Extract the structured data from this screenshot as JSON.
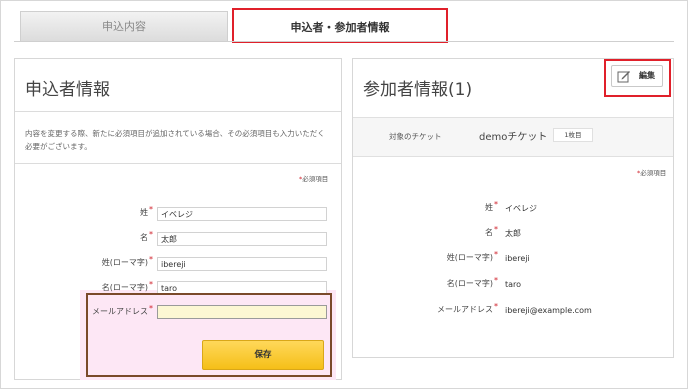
{
  "tabs": [
    {
      "label": "申込内容"
    },
    {
      "label": "申込者・参加者情報"
    }
  ],
  "applicant": {
    "title": "申込者情報",
    "notice": "内容を変更する際、新たに必須項目が追加されている場合、その必須項目も入力いただく必要がございます。",
    "required_mark": "*",
    "required_note": "必須項目",
    "fields": [
      {
        "label": "姓",
        "value": ""
      },
      {
        "label": "名",
        "value": ""
      },
      {
        "label": "姓(ローマ字)",
        "value": "ibereji"
      },
      {
        "label": "名(ローマ字)",
        "value": "taro"
      },
      {
        "label": "メールアドレス",
        "value": ""
      }
    ],
    "field_values_jp": [
      "イベレジ",
      "太郎"
    ],
    "save_label": "保存"
  },
  "participant": {
    "title": "参加者情報(1)",
    "edit_label": "編集",
    "ticket_label": "対象のチケット",
    "ticket_name": "demoチケット",
    "ticket_count": "1枚目",
    "required_note": "必須項目",
    "fields": [
      {
        "label": "姓",
        "value": "イベレジ"
      },
      {
        "label": "名",
        "value": "太郎"
      },
      {
        "label": "姓(ローマ字)",
        "value": "ibereji"
      },
      {
        "label": "名(ローマ字)",
        "value": "taro"
      },
      {
        "label": "メールアドレス",
        "value": "ibereji@example.com"
      }
    ]
  },
  "colors": {
    "highlight_red": "#e0202a",
    "highlight_brown": "#7a4a2a",
    "save_button": "#f5bf18"
  },
  "icons": [
    "edit-icon"
  ]
}
